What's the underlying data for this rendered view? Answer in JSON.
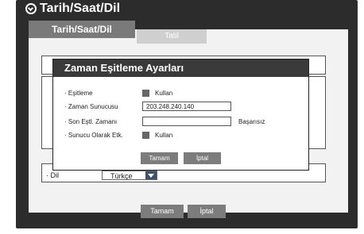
{
  "window": {
    "title": "Tarih/Saat/Dil"
  },
  "tabs": [
    {
      "label": "Tarih/Saat/Dil"
    },
    {
      "label": "Tatil"
    }
  ],
  "language": {
    "label": "· Dil",
    "value": "Türkçe"
  },
  "footer": {
    "ok": "Tamam",
    "cancel": "İptal"
  },
  "dialog": {
    "title": "Zaman Eşitleme Ayarları",
    "rows": [
      {
        "label": "· Eşitleme",
        "check_label": "Kullan"
      },
      {
        "label": "· Zaman Sunucusu",
        "value": "203.248.240.140"
      },
      {
        "label": "· Son Eştl. Zamanı",
        "value": "",
        "status": "Başarısız"
      },
      {
        "label": "· Sunucu Olarak Etk.",
        "check_label": "Kullan"
      }
    ],
    "ok": "Tamam",
    "cancel": "İptal"
  }
}
